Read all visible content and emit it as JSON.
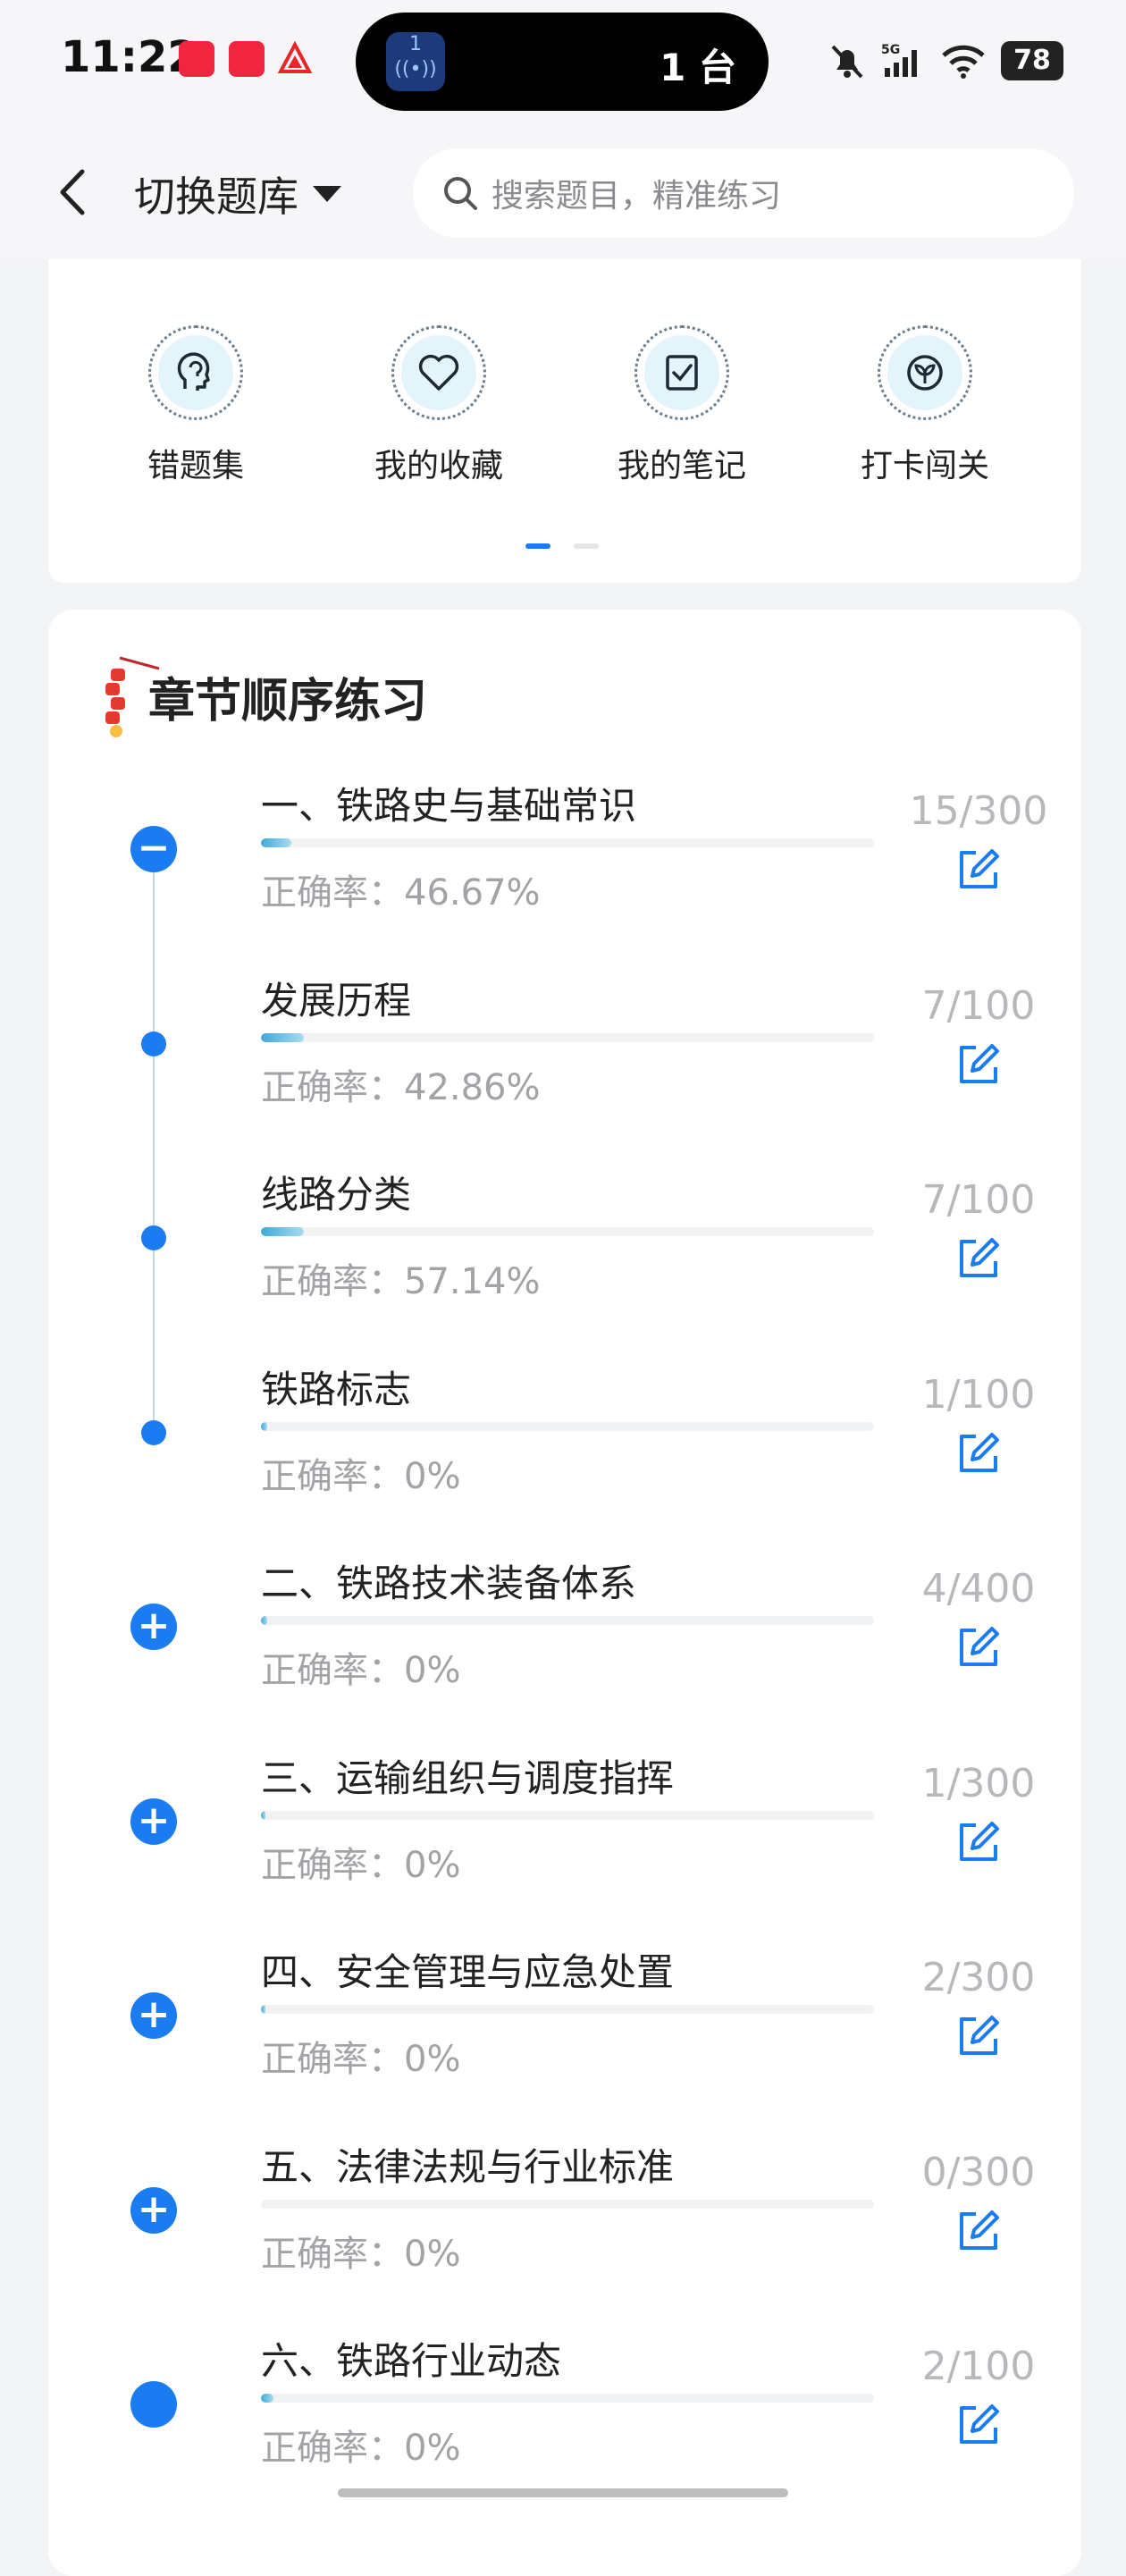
{
  "status": {
    "time": "11:22",
    "island_text": "1 台",
    "island_badge": "1",
    "battery": "78",
    "network": "5G"
  },
  "header": {
    "title": "切换题库",
    "search_placeholder": "搜索题目，精准练习"
  },
  "tools": [
    {
      "label": "错题集",
      "icon": "head-icon"
    },
    {
      "label": "我的收藏",
      "icon": "heart-icon"
    },
    {
      "label": "我的笔记",
      "icon": "note-check-icon"
    },
    {
      "label": "打卡闯关",
      "icon": "sprout-icon"
    }
  ],
  "chapters_section": {
    "title": "章节顺序练习",
    "accuracy_prefix": "正确率："
  },
  "chapters": [
    {
      "title": "一、铁路史与基础常识",
      "accuracy": "正确率：46.67%",
      "count": "15/300",
      "progress": 0.05,
      "node": "minus"
    },
    {
      "title": "发展历程",
      "accuracy": "正确率：42.86%",
      "count": "7/100",
      "progress": 0.07,
      "node": "dot"
    },
    {
      "title": "线路分类",
      "accuracy": "正确率：57.14%",
      "count": "7/100",
      "progress": 0.07,
      "node": "dot"
    },
    {
      "title": "铁路标志",
      "accuracy": "正确率：0%",
      "count": "1/100",
      "progress": 0.01,
      "node": "dot"
    },
    {
      "title": "二、铁路技术装备体系",
      "accuracy": "正确率：0%",
      "count": "4/400",
      "progress": 0.01,
      "node": "plus"
    },
    {
      "title": "三、运输组织与调度指挥",
      "accuracy": "正确率：0%",
      "count": "1/300",
      "progress": 0.003,
      "node": "plus"
    },
    {
      "title": "四、安全管理与应急处置",
      "accuracy": "正确率：0%",
      "count": "2/300",
      "progress": 0.007,
      "node": "plus"
    },
    {
      "title": "五、法律法规与行业标准",
      "accuracy": "正确率：0%",
      "count": "0/300",
      "progress": 0,
      "node": "plus"
    },
    {
      "title": "六、铁路行业动态",
      "accuracy": "正确率：0%",
      "count": "2/100",
      "progress": 0.02,
      "node": "filled"
    }
  ],
  "colors": {
    "accent": "#1a7cf0",
    "progress_start": "#3ea8d8",
    "progress_end": "#a9dcf0",
    "muted_text": "#a3a3a7"
  }
}
